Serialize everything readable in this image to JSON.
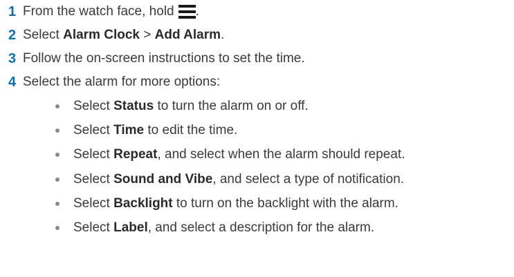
{
  "steps": [
    {
      "num": "1",
      "pre": "From the watch face, hold",
      "post": "."
    },
    {
      "num": "2",
      "pre": "Select ",
      "b1": "Alarm Clock",
      "mid": " > ",
      "b2": "Add Alarm",
      "post": "."
    },
    {
      "num": "3",
      "text": "Follow the on-screen instructions to set the time."
    },
    {
      "num": "4",
      "text": "Select the alarm for more options:"
    }
  ],
  "bullets": [
    {
      "pre": "Select ",
      "bold": "Status",
      "post": " to turn the alarm on or off."
    },
    {
      "pre": "Select ",
      "bold": "Time",
      "post": " to edit the time."
    },
    {
      "pre": "Select ",
      "bold": "Repeat",
      "post": ", and select when the alarm should repeat."
    },
    {
      "pre": "Select ",
      "bold": "Sound and Vibe",
      "post": ", and select a type of notification."
    },
    {
      "pre": "Select ",
      "bold": "Backlight",
      "post": " to turn on the backlight with the alarm."
    },
    {
      "pre": "Select ",
      "bold": "Label",
      "post": ", and select a description for the alarm."
    }
  ],
  "icons": {
    "menu": "menu-icon"
  },
  "colors": {
    "step_number": "#0c6fb0",
    "text": "#3a3a3a",
    "bullet": "#8a8a8a"
  }
}
